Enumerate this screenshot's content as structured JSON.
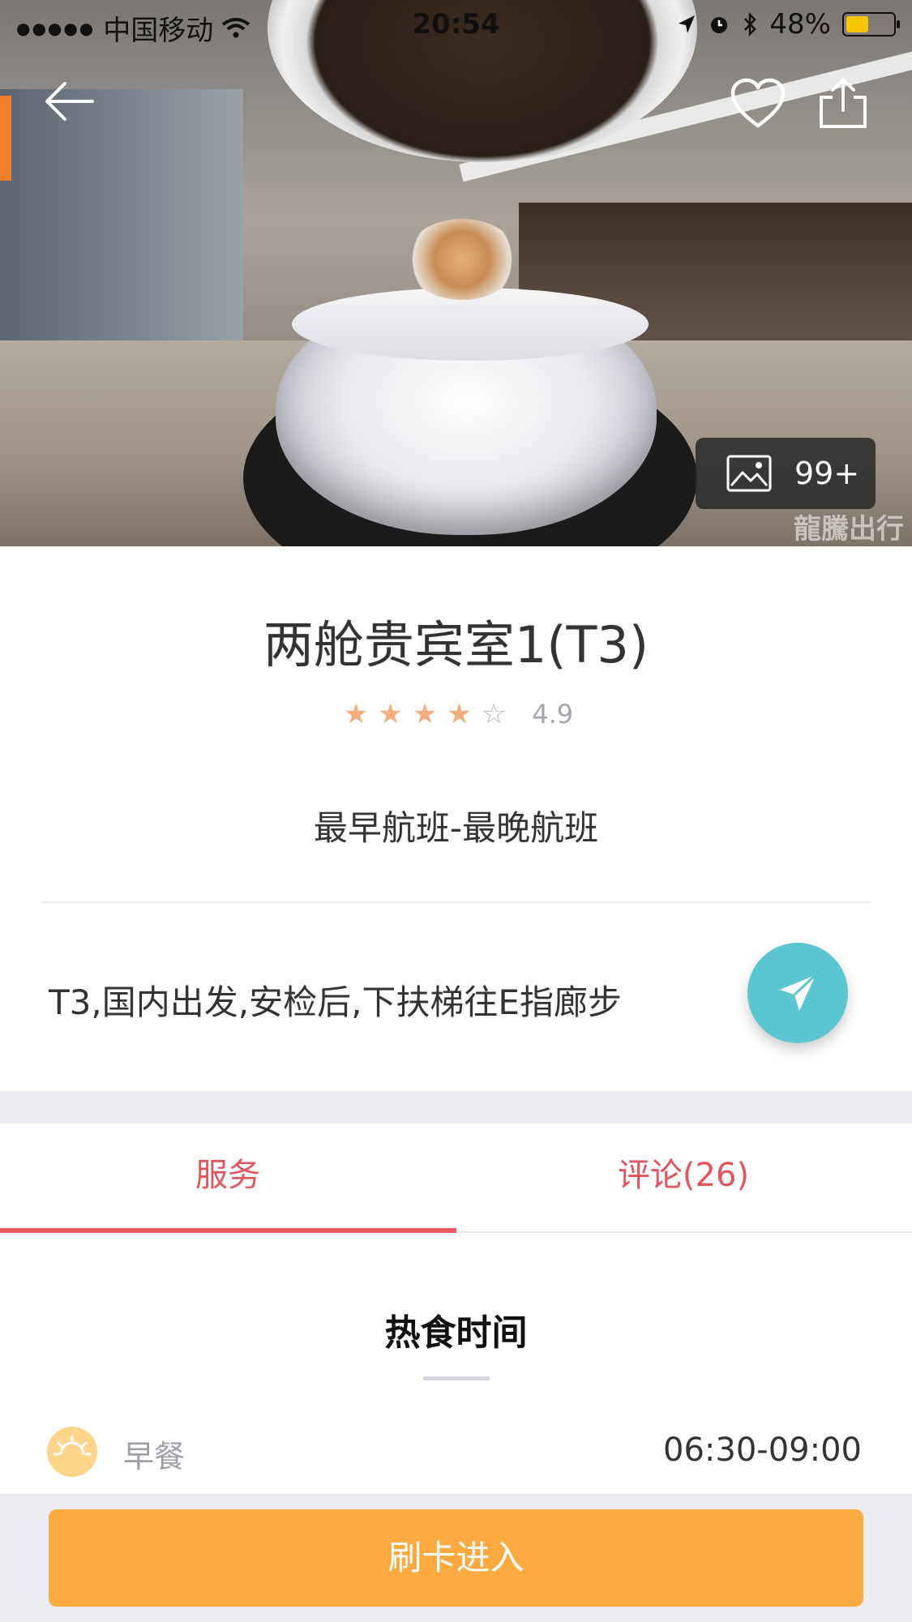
{
  "status_bar": {
    "carrier": "中国移动",
    "time": "20:54",
    "battery": "48%",
    "battery_level": 0.48
  },
  "icons": {
    "back": "arrow-left-icon",
    "favorite": "heart-outline-icon",
    "share": "share-upload-icon",
    "gallery": "image-icon",
    "navigate": "paper-plane-icon",
    "breakfast": "sunrise-icon"
  },
  "hero": {
    "photo_count": "99+",
    "watermark": "龍騰出行"
  },
  "lounge": {
    "title": "两舱贵宾室1(T3)",
    "rating_stars": 4,
    "rating_max": 5,
    "score": "4.9",
    "hours": "最早航班-最晚航班",
    "address": "T3,国内出发,安检后,下扶梯往E指廊步"
  },
  "tabs": [
    {
      "label": "服务",
      "active": true
    },
    {
      "label": "评论(26)",
      "active": false
    }
  ],
  "section": {
    "title": "热食时间",
    "meals": [
      {
        "label": "早餐",
        "time": "06:30-09:00"
      }
    ]
  },
  "action": {
    "label": "刷卡进入"
  },
  "colors": {
    "accent_red": "#ec5b61",
    "action_orange": "#fdab40",
    "nav_teal": "#5bc6cf",
    "star": "#f6ad7e"
  }
}
